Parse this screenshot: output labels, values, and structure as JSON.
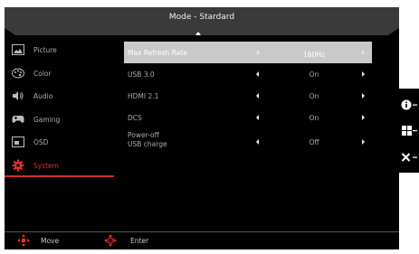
{
  "header": {
    "title": "Mode - Stardard"
  },
  "sidebar": {
    "items": [
      {
        "label": "Picture",
        "icon": "picture-icon"
      },
      {
        "label": "Color",
        "icon": "color-palette-icon"
      },
      {
        "label": "Audio",
        "icon": "speaker-icon"
      },
      {
        "label": "Gaming",
        "icon": "gamepad-icon"
      },
      {
        "label": "OSD",
        "icon": "osd-icon"
      },
      {
        "label": "System",
        "icon": "gear-icon"
      }
    ]
  },
  "settings": {
    "rows": [
      {
        "name": "Max Refresh Rate",
        "value": "160Hz"
      },
      {
        "name": "USB 3.0",
        "value": "On"
      },
      {
        "name": "HDMI 2.1",
        "value": "On"
      },
      {
        "name": "DCS",
        "value": "On"
      },
      {
        "name_line1": "Power-off",
        "name_line2": "USB charge",
        "value": "Off"
      }
    ]
  },
  "footer": {
    "move_label": "Move",
    "enter_label": "Enter"
  },
  "colors": {
    "accent": "#d32c27",
    "header_bg": "#3a3a3a",
    "selected_row": "#c9c9c9",
    "panel_bg": "#000000"
  }
}
